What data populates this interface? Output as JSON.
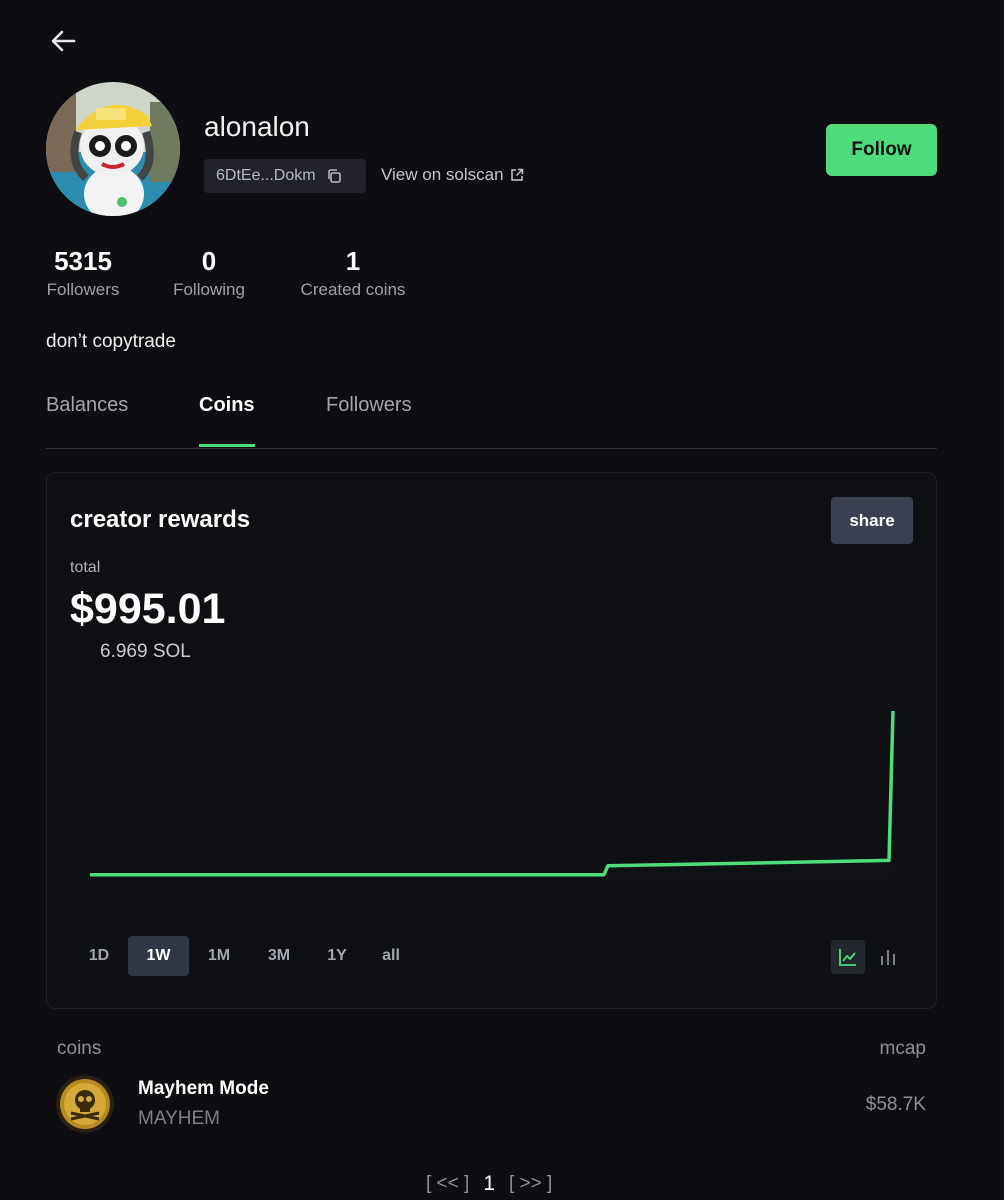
{
  "profile": {
    "username": "alonalon",
    "address_short": "6DtEe...Dokm",
    "solscan_label": "View on solscan",
    "follow_label": "Follow",
    "bio": "don’t copytrade"
  },
  "stats": [
    {
      "value": "5315",
      "label": "Followers"
    },
    {
      "value": "0",
      "label": "Following"
    },
    {
      "value": "1",
      "label": "Created coins"
    }
  ],
  "tabs": [
    {
      "label": "Balances",
      "active": false
    },
    {
      "label": "Coins",
      "active": true
    },
    {
      "label": "Followers",
      "active": false
    }
  ],
  "rewards": {
    "title": "creator rewards",
    "share_label": "share",
    "total_label": "total",
    "total_usd": "$995.01",
    "total_sol": "6.969 SOL",
    "ranges": [
      "1D",
      "1W",
      "1M",
      "3M",
      "1Y",
      "all"
    ],
    "active_range": "1W",
    "chart_modes": [
      "line-chart-icon",
      "bar-chart-icon"
    ],
    "active_mode": "line-chart-icon"
  },
  "chart_data": {
    "type": "line",
    "x": [
      0,
      0.64,
      0.645,
      0.995,
      1.0
    ],
    "y": [
      0.09,
      0.09,
      0.14,
      0.17,
      1.0
    ],
    "color": "#4fdc7d"
  },
  "coins_table": {
    "header_left": "coins",
    "header_right": "mcap",
    "rows": [
      {
        "name": "Mayhem Mode",
        "ticker": "MAYHEM",
        "mcap": "$58.7K"
      }
    ]
  },
  "pagination": {
    "prev": "[ << ]",
    "current": "1",
    "next": "[ >> ]"
  },
  "colors": {
    "accent": "#4fdc7d",
    "background": "#0e0e12"
  }
}
